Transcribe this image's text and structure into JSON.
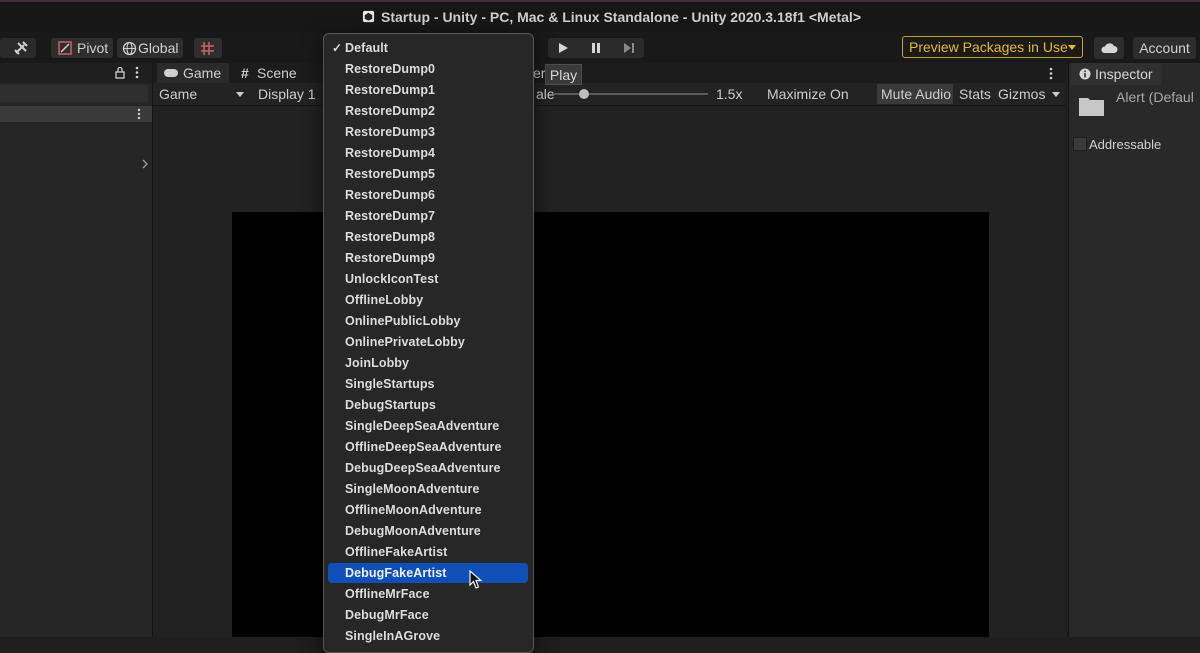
{
  "window": {
    "title": "Startup - Unity - PC, Mac & Linux Standalone - Unity 2020.3.18f1 <Metal>"
  },
  "toolbar": {
    "pivot_label": "Pivot",
    "global_label": "Global",
    "preview_packages_label": "Preview Packages in Use",
    "account_label": "Account"
  },
  "tabs": {
    "game": "Game",
    "scene": "Scene",
    "truncated_right": "er"
  },
  "game_toolbar": {
    "display_mode": "Game",
    "display": "Display 1",
    "scale_label_fragment": "ale",
    "scale_value": "1.5x",
    "maximize_on_play": "Maximize On Play",
    "mute_audio": "Mute Audio",
    "stats": "Stats",
    "gizmos": "Gizmos"
  },
  "tooltip": {
    "text": "Play"
  },
  "inspector": {
    "tab_label": "Inspector",
    "object_name": "Alert (Defaul",
    "addressable_label": "Addressable"
  },
  "dropdown": {
    "items": [
      {
        "label": "Default",
        "checked": true
      },
      {
        "label": "RestoreDump0"
      },
      {
        "label": "RestoreDump1"
      },
      {
        "label": "RestoreDump2"
      },
      {
        "label": "RestoreDump3"
      },
      {
        "label": "RestoreDump4"
      },
      {
        "label": "RestoreDump5"
      },
      {
        "label": "RestoreDump6"
      },
      {
        "label": "RestoreDump7"
      },
      {
        "label": "RestoreDump8"
      },
      {
        "label": "RestoreDump9"
      },
      {
        "label": "UnlockIconTest"
      },
      {
        "label": "OfflineLobby"
      },
      {
        "label": "OnlinePublicLobby"
      },
      {
        "label": "OnlinePrivateLobby"
      },
      {
        "label": "JoinLobby"
      },
      {
        "label": "SingleStartups"
      },
      {
        "label": "DebugStartups"
      },
      {
        "label": "SingleDeepSeaAdventure"
      },
      {
        "label": "OfflineDeepSeaAdventure"
      },
      {
        "label": "DebugDeepSeaAdventure"
      },
      {
        "label": "SingleMoonAdventure"
      },
      {
        "label": "OfflineMoonAdventure"
      },
      {
        "label": "DebugMoonAdventure"
      },
      {
        "label": "OfflineFakeArtist"
      },
      {
        "label": "DebugFakeArtist",
        "selected": true
      },
      {
        "label": "OfflineMrFace"
      },
      {
        "label": "DebugMrFace"
      },
      {
        "label": "SingleInAGrove"
      }
    ]
  },
  "colors": {
    "accent": "#0f4fb8",
    "warning": "#e8b92b"
  },
  "icons": [
    "unity-logo-icon",
    "tools-icon",
    "pivot-icon",
    "global-icon",
    "grid-snap-icon",
    "play-icon",
    "pause-icon",
    "step-icon",
    "cloud-icon",
    "lock-icon",
    "kebab-menu-icon",
    "chevron-right-icon",
    "info-icon",
    "folder-icon",
    "cursor-icon"
  ]
}
